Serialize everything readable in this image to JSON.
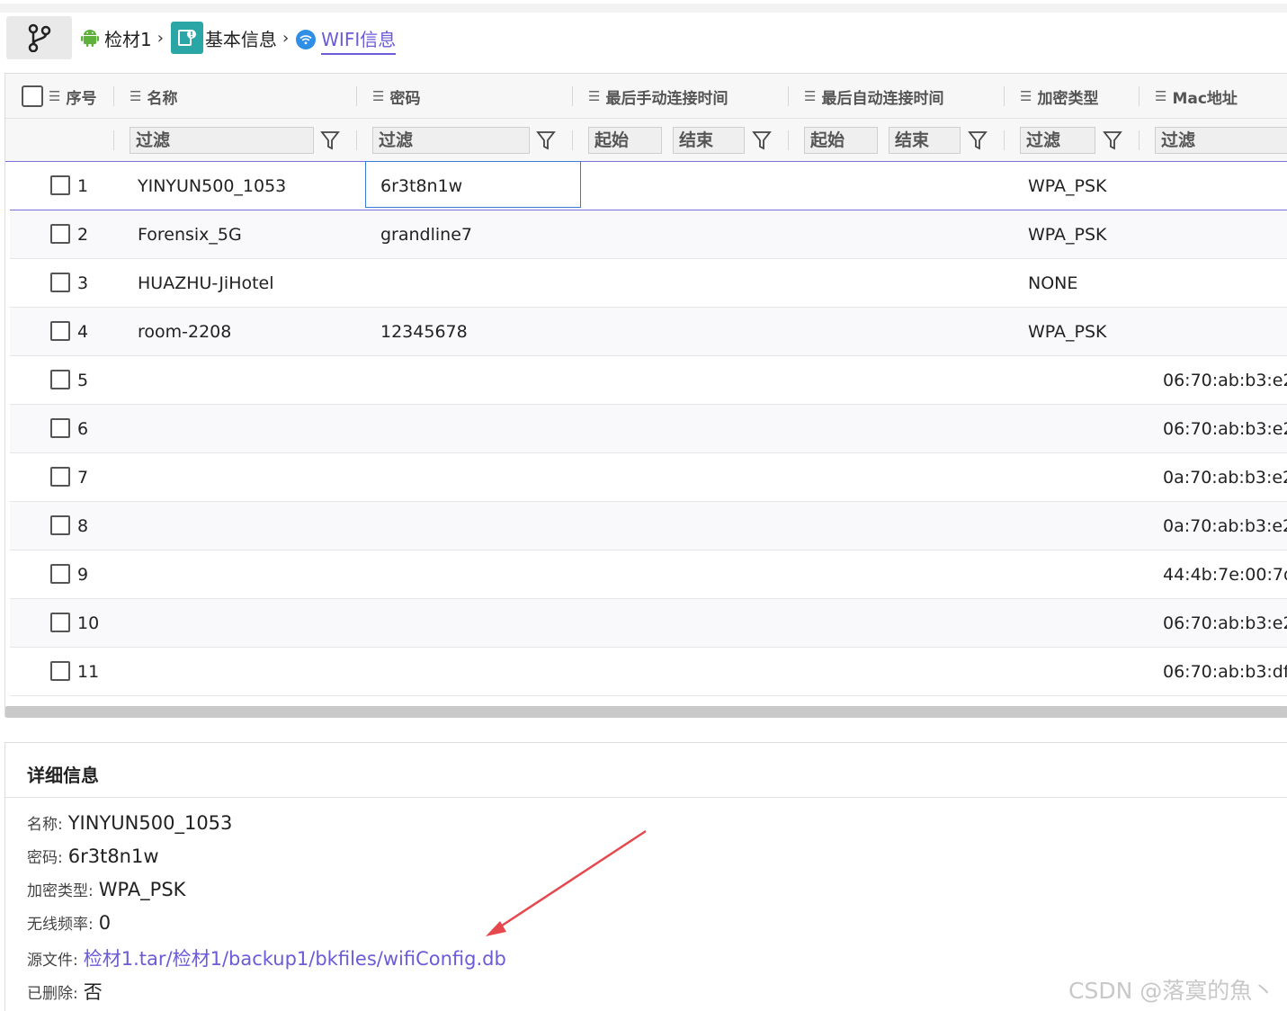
{
  "breadcrumb": {
    "items": [
      "检材1",
      "基本信息",
      "WIFI信息"
    ]
  },
  "table": {
    "select_all": "",
    "columns": [
      "序号",
      "名称",
      "密码",
      "最后手动连接时间",
      "最后自动连接时间",
      "加密类型",
      "Mac地址"
    ],
    "filters": {
      "name": "过滤",
      "password": "过滤",
      "manual_start": "起始",
      "manual_end": "结束",
      "auto_start": "起始",
      "auto_end": "结束",
      "enc": "过滤",
      "mac": "过滤"
    },
    "rows": [
      {
        "idx": "1",
        "name": "YINYUN500_1053",
        "password": "6r3t8n1w",
        "enc": "WPA_PSK",
        "mac": ""
      },
      {
        "idx": "2",
        "name": "Forensix_5G",
        "password": "grandline7",
        "enc": "WPA_PSK",
        "mac": ""
      },
      {
        "idx": "3",
        "name": "HUAZHU-JiHotel",
        "password": "",
        "enc": "NONE",
        "mac": ""
      },
      {
        "idx": "4",
        "name": "room-2208",
        "password": "12345678",
        "enc": "WPA_PSK",
        "mac": ""
      },
      {
        "idx": "5",
        "name": "",
        "password": "",
        "enc": "",
        "mac": "06:70:ab:b3:e2:"
      },
      {
        "idx": "6",
        "name": "",
        "password": "",
        "enc": "",
        "mac": "06:70:ab:b3:e2:"
      },
      {
        "idx": "7",
        "name": "",
        "password": "",
        "enc": "",
        "mac": "0a:70:ab:b3:e2:"
      },
      {
        "idx": "8",
        "name": "",
        "password": "",
        "enc": "",
        "mac": "0a:70:ab:b3:e2:"
      },
      {
        "idx": "9",
        "name": "",
        "password": "",
        "enc": "",
        "mac": "44:4b:7e:00:7d:"
      },
      {
        "idx": "10",
        "name": "",
        "password": "",
        "enc": "",
        "mac": "06:70:ab:b3:e2:"
      },
      {
        "idx": "11",
        "name": "",
        "password": "",
        "enc": "",
        "mac": "06:70:ab:b3:df:b"
      }
    ]
  },
  "detail": {
    "title": "详细信息",
    "fields": [
      {
        "key": "名称:",
        "value": "YINYUN500_1053"
      },
      {
        "key": "密码:",
        "value": "6r3t8n1w"
      },
      {
        "key": "加密类型:",
        "value": "WPA_PSK"
      },
      {
        "key": "无线频率:",
        "value": "0"
      },
      {
        "key": "源文件:",
        "value": "检材1.tar/检材1/backup1/bkfiles/wifiConfig.db"
      },
      {
        "key": "已删除:",
        "value": "否"
      }
    ]
  },
  "watermark": "CSDN @落寞的魚丶",
  "colors": {
    "accent": "#6b5bd6",
    "arrow": "#e5484d"
  },
  "icons": [
    "branch-icon",
    "android-icon",
    "info-icon",
    "wifi-icon",
    "list-icon",
    "funnel-icon"
  ]
}
